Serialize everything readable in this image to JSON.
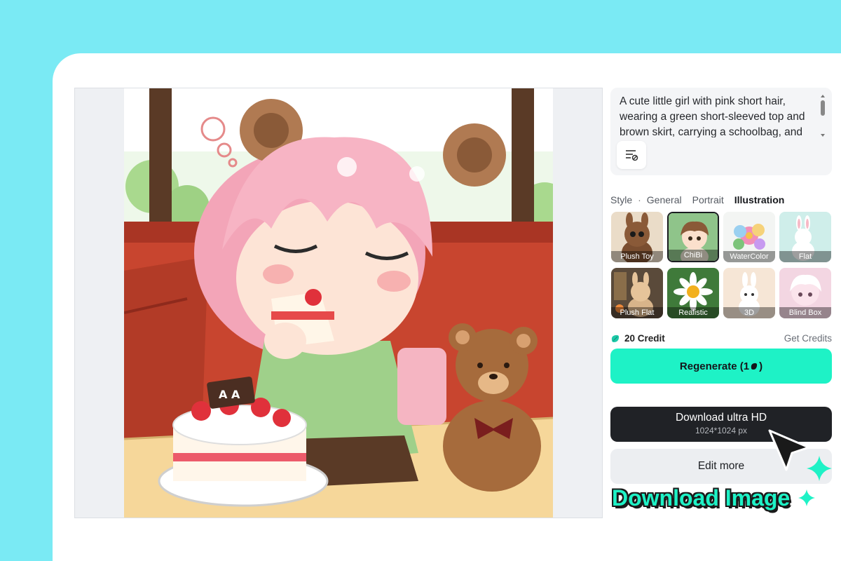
{
  "colors": {
    "background": "#7aeaf4",
    "accent": "#1ef2c6",
    "dark_button": "#202226"
  },
  "image": {
    "description_icon": "generated-image",
    "cake_plaque_text": "A A"
  },
  "prompt": {
    "text": "A cute little girl with pink short hair, wearing a green short-sleeved top and brown skirt, carrying a schoolbag, and",
    "tool_icon": "prompt-settings-icon"
  },
  "style": {
    "label": "Style",
    "separator": "·",
    "tabs": [
      "General",
      "Portrait",
      "Illustration"
    ],
    "active_tab": "Illustration"
  },
  "styles": [
    {
      "label": "Plush Toy"
    },
    {
      "label": "ChiBi",
      "selected": true
    },
    {
      "label": "WaterColor"
    },
    {
      "label": "Flat"
    },
    {
      "label": "Plush Flat"
    },
    {
      "label": "Realistic"
    },
    {
      "label": "3D"
    },
    {
      "label": "Blind Box"
    }
  ],
  "credits": {
    "balance": "20 Credit",
    "get_credits": "Get Credits",
    "icon": "credit-bean-icon"
  },
  "buttons": {
    "regenerate": "Regenerate (1",
    "regenerate_suffix": ")",
    "download_title": "Download ultra HD",
    "download_size": "1024*1024 px",
    "edit_more": "Edit more"
  },
  "callout": {
    "text": "Download Image"
  }
}
